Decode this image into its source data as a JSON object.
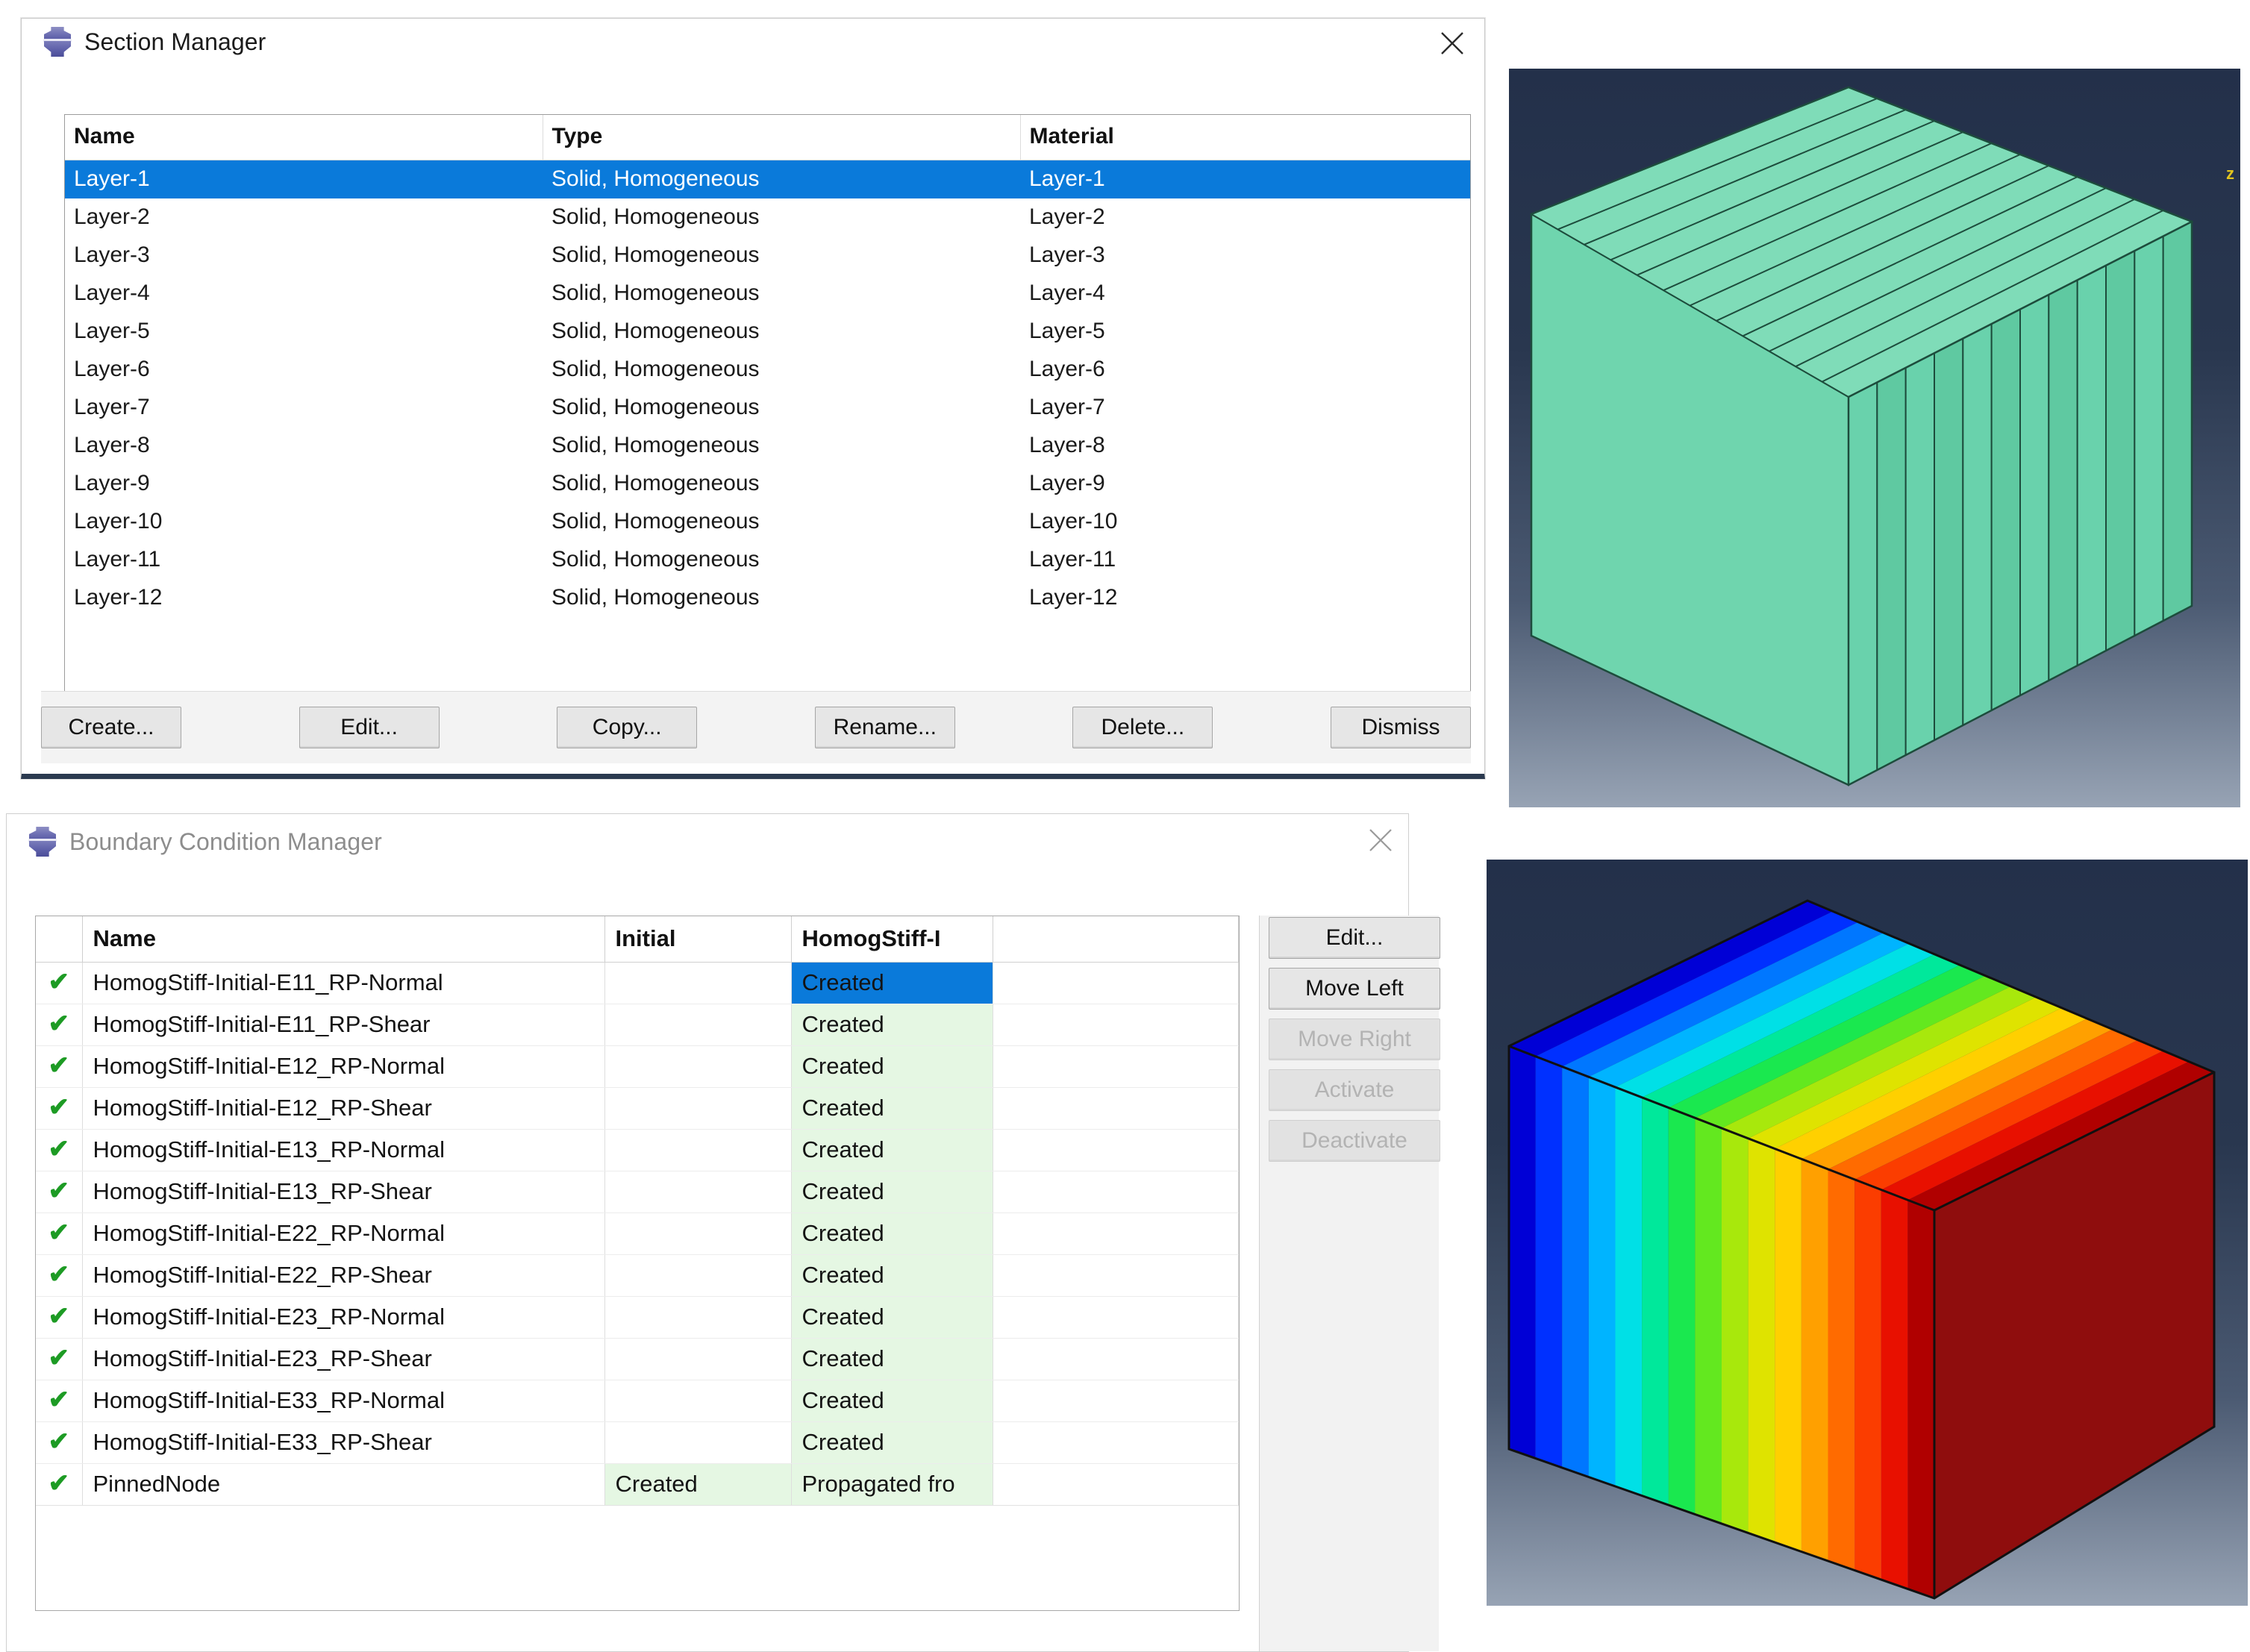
{
  "section_manager": {
    "title": "Section Manager",
    "icon": "abaqus-icon",
    "close_icon": "close-icon",
    "columns": [
      "Name",
      "Type",
      "Material"
    ],
    "rows": [
      {
        "name": "Layer-1",
        "type": "Solid, Homogeneous",
        "material": "Layer-1",
        "selected": true
      },
      {
        "name": "Layer-2",
        "type": "Solid, Homogeneous",
        "material": "Layer-2",
        "selected": false
      },
      {
        "name": "Layer-3",
        "type": "Solid, Homogeneous",
        "material": "Layer-3",
        "selected": false
      },
      {
        "name": "Layer-4",
        "type": "Solid, Homogeneous",
        "material": "Layer-4",
        "selected": false
      },
      {
        "name": "Layer-5",
        "type": "Solid, Homogeneous",
        "material": "Layer-5",
        "selected": false
      },
      {
        "name": "Layer-6",
        "type": "Solid, Homogeneous",
        "material": "Layer-6",
        "selected": false
      },
      {
        "name": "Layer-7",
        "type": "Solid, Homogeneous",
        "material": "Layer-7",
        "selected": false
      },
      {
        "name": "Layer-8",
        "type": "Solid, Homogeneous",
        "material": "Layer-8",
        "selected": false
      },
      {
        "name": "Layer-9",
        "type": "Solid, Homogeneous",
        "material": "Layer-9",
        "selected": false
      },
      {
        "name": "Layer-10",
        "type": "Solid, Homogeneous",
        "material": "Layer-10",
        "selected": false
      },
      {
        "name": "Layer-11",
        "type": "Solid, Homogeneous",
        "material": "Layer-11",
        "selected": false
      },
      {
        "name": "Layer-12",
        "type": "Solid, Homogeneous",
        "material": "Layer-12",
        "selected": false
      }
    ],
    "buttons": [
      {
        "label": "Create...",
        "enabled": true
      },
      {
        "label": "Edit...",
        "enabled": true
      },
      {
        "label": "Copy...",
        "enabled": true
      },
      {
        "label": "Rename...",
        "enabled": true
      },
      {
        "label": "Delete...",
        "enabled": true
      },
      {
        "label": "Dismiss",
        "enabled": true
      }
    ]
  },
  "bc_manager": {
    "title": "Boundary Condition Manager",
    "icon": "abaqus-icon",
    "close_icon": "close-icon",
    "columns": [
      "",
      "Name",
      "Initial",
      "HomogStiff-I",
      ""
    ],
    "rows": [
      {
        "check": "✔",
        "name": "HomogStiff-Initial-E11_RP-Normal",
        "initial": "",
        "step": "Created",
        "step_state": "selected"
      },
      {
        "check": "✔",
        "name": "HomogStiff-Initial-E11_RP-Shear",
        "initial": "",
        "step": "Created",
        "step_state": "created"
      },
      {
        "check": "✔",
        "name": "HomogStiff-Initial-E12_RP-Normal",
        "initial": "",
        "step": "Created",
        "step_state": "created"
      },
      {
        "check": "✔",
        "name": "HomogStiff-Initial-E12_RP-Shear",
        "initial": "",
        "step": "Created",
        "step_state": "created"
      },
      {
        "check": "✔",
        "name": "HomogStiff-Initial-E13_RP-Normal",
        "initial": "",
        "step": "Created",
        "step_state": "created"
      },
      {
        "check": "✔",
        "name": "HomogStiff-Initial-E13_RP-Shear",
        "initial": "",
        "step": "Created",
        "step_state": "created"
      },
      {
        "check": "✔",
        "name": "HomogStiff-Initial-E22_RP-Normal",
        "initial": "",
        "step": "Created",
        "step_state": "created"
      },
      {
        "check": "✔",
        "name": "HomogStiff-Initial-E22_RP-Shear",
        "initial": "",
        "step": "Created",
        "step_state": "created"
      },
      {
        "check": "✔",
        "name": "HomogStiff-Initial-E23_RP-Normal",
        "initial": "",
        "step": "Created",
        "step_state": "created"
      },
      {
        "check": "✔",
        "name": "HomogStiff-Initial-E23_RP-Shear",
        "initial": "",
        "step": "Created",
        "step_state": "created"
      },
      {
        "check": "✔",
        "name": "HomogStiff-Initial-E33_RP-Normal",
        "initial": "",
        "step": "Created",
        "step_state": "created"
      },
      {
        "check": "✔",
        "name": "HomogStiff-Initial-E33_RP-Shear",
        "initial": "",
        "step": "Created",
        "step_state": "created"
      },
      {
        "check": "✔",
        "name": "PinnedNode",
        "initial": "Created",
        "step": "Propagated fro",
        "step_state": "created"
      }
    ],
    "buttons": [
      {
        "label": "Edit...",
        "enabled": true
      },
      {
        "label": "Move Left",
        "enabled": true
      },
      {
        "label": "Move Right",
        "enabled": false
      },
      {
        "label": "Activate",
        "enabled": false
      },
      {
        "label": "Deactivate",
        "enabled": false
      }
    ]
  },
  "viewports": {
    "layered": {
      "name": "layered-block-view",
      "axis_label_z": "z",
      "face_color": "#69d6ad",
      "layer_count": 12
    },
    "contour": {
      "name": "contour-block-view",
      "contour_colors": [
        "#0000d6",
        "#0030ff",
        "#0077ff",
        "#00b4ff",
        "#00e0e6",
        "#00e89b",
        "#1ae84f",
        "#63e81f",
        "#a8e80c",
        "#dfe300",
        "#ffd000",
        "#ffa000",
        "#ff6b00",
        "#fb3d00",
        "#e81000",
        "#b00000"
      ],
      "band_count": 16
    }
  },
  "colors": {
    "selection_blue": "#0a7ada",
    "created_green": "#e5f7e3",
    "tick_green": "#1d9b24",
    "window_border": "#2b3a4f"
  }
}
